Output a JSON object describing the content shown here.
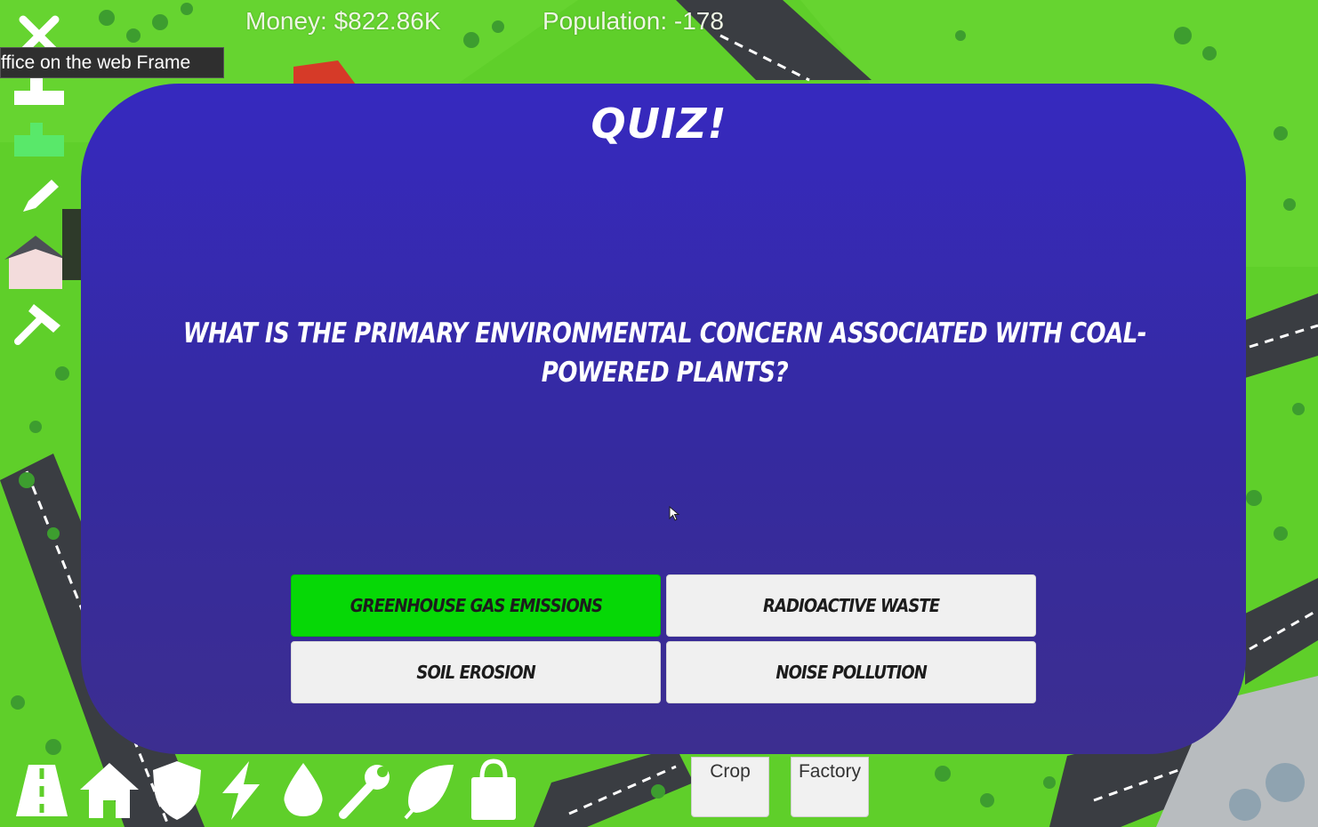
{
  "hud": {
    "money": "Money: $822.86K",
    "population": "Population: -178",
    "frame_tooltip": "ffice on the web Frame"
  },
  "side_toolbar": [
    {
      "name": "close-icon"
    },
    {
      "name": "road-tool-icon"
    },
    {
      "name": "zone-tool-icon"
    },
    {
      "name": "pencil-icon"
    },
    {
      "name": "house-preview-icon"
    },
    {
      "name": "hammer-icon"
    }
  ],
  "quiz": {
    "title": "QUIZ!",
    "question": "WHAT IS THE PRIMARY ENVIRONMENTAL CONCERN ASSOCIATED WITH COAL-POWERED PLANTS?",
    "answers": [
      {
        "label": "GREENHOUSE GAS EMISSIONS",
        "state": "selected",
        "color": "#06d806"
      },
      {
        "label": "RADIOACTIVE WASTE",
        "state": "default"
      },
      {
        "label": "SOIL EROSION",
        "state": "default"
      },
      {
        "label": "NOISE POLLUTION",
        "state": "default"
      }
    ]
  },
  "bottom_bar": {
    "icons": [
      "road-icon",
      "house-icon",
      "shield-icon",
      "lightning-icon",
      "water-drop-icon",
      "wrench-icon",
      "leaf-icon",
      "shopping-bag-icon"
    ],
    "tabs": [
      {
        "label": "Crop"
      },
      {
        "label": "Factory"
      }
    ]
  },
  "colors": {
    "panel": "#3629bf",
    "grass": "#5fcf2a",
    "road": "#3a3d42",
    "selected_answer": "#06d806"
  }
}
